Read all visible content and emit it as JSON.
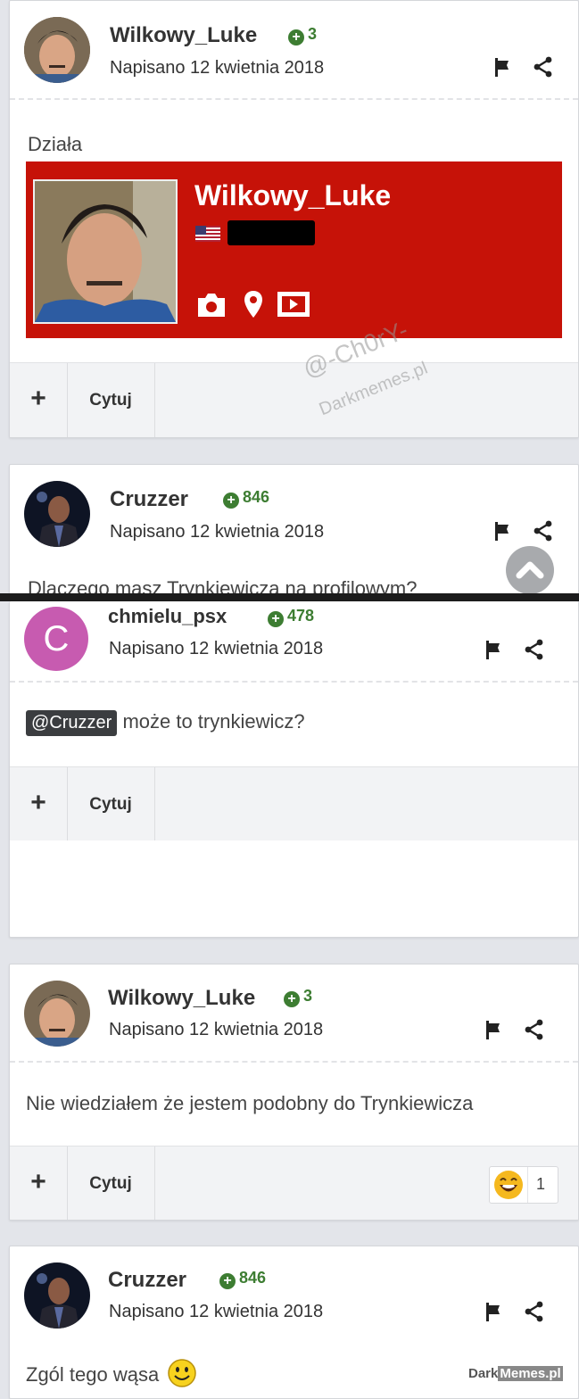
{
  "posts": [
    {
      "author": "Wilkowy_Luke",
      "rep": "3",
      "date": "Napisano 12 kwietnia 2018",
      "text": "Działa"
    },
    {
      "author": "Cruzzer",
      "rep": "846",
      "date": "Napisano 12 kwietnia 2018",
      "text": "Dlaczego masz Trynkiewicza na profilowym?"
    },
    {
      "author": "chmielu_psx",
      "avatar_letter": "C",
      "rep": "478",
      "date": "Napisano 12 kwietnia 2018",
      "mention": "@Cruzzer",
      "text": "może to trynkiewicz?"
    },
    {
      "author": "Wilkowy_Luke",
      "rep": "3",
      "date": "Napisano 12 kwietnia 2018",
      "text": "Nie wiedziałem że jestem podobny do Trynkiewicza",
      "reaction_count": "1"
    },
    {
      "author": "Cruzzer",
      "rep": "846",
      "date": "Napisano 12 kwietnia 2018",
      "text": "Zgól tego wąsa"
    }
  ],
  "banner": {
    "username": "Wilkowy_Luke"
  },
  "toolbar": {
    "plus": "+",
    "quote": "Cytuj"
  },
  "watermark": {
    "line1": "@-Ch0rY-",
    "line2": "Darkmemes.pl",
    "corner_a": "Dark",
    "corner_b": "Memes.pl"
  },
  "colors": {
    "rep_green": "#3d7d32",
    "banner_red": "#c61208",
    "avatar_purple": "#c75bb0"
  },
  "icons": [
    "flag-icon",
    "share-icon",
    "camera-icon",
    "map-pin-icon",
    "video-icon",
    "us-flag-icon",
    "scroll-up-icon",
    "laughing-emoji-icon",
    "smiley-emoji-icon"
  ]
}
